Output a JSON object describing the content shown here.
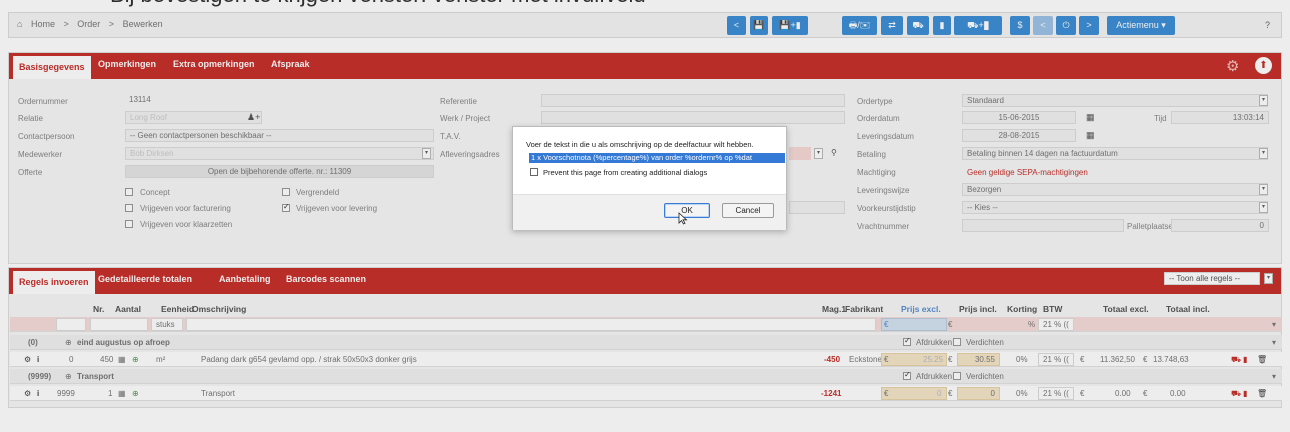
{
  "top_fragment": "Bij bevestigen te krijgen venster: venster met invulfveld",
  "breadcrumb": [
    "Home",
    ">",
    "Order",
    ">",
    "Bewerken"
  ],
  "toolbar": {
    "buttons": [
      "<",
      "💾",
      "💾+▮",
      "🖶/✉",
      "⇄",
      "⛟",
      "▮",
      "⛟+▮",
      "$",
      "<",
      "⏻",
      ">"
    ],
    "actiemenu": "Actiemenu ▾",
    "help": "?"
  },
  "basis": {
    "tabs": [
      "Basisgegevens",
      "Opmerkingen",
      "Extra opmerkingen",
      "Afspraak"
    ],
    "left": {
      "ordernummer_label": "Ordernummer",
      "ordernummer": "13114",
      "relatie_label": "Relatie",
      "relatie": "Long Roof",
      "contactpersoon_label": "Contactpersoon",
      "contactpersoon": "-- Geen contactpersonen beschikbaar --",
      "medewerker_label": "Medewerker",
      "medewerker": "Bob Dirksen",
      "offerte_label": "Offerte",
      "offerte": "Open de bijbehorende offerte. nr.: 11309"
    },
    "checks": {
      "concept": "Concept",
      "vergrendeld": "Vergrendeld",
      "facturering": "Vrijgeven voor facturering",
      "levering": "Vrijgeven voor levering",
      "klaarzetten": "Vrijgeven voor klaarzetten"
    },
    "mid": {
      "referentie": "Referentie",
      "werk": "Werk / Project",
      "tav": "T.A.V.",
      "aflevering": "Afleveringsadres"
    },
    "right": {
      "ordertype_label": "Ordertype",
      "ordertype": "Standaard",
      "orderdatum_label": "Orderdatum",
      "orderdatum": "15-06-2015",
      "tijd_label": "Tijd",
      "tijd": "13:03:14",
      "leveringsdatum_label": "Leveringsdatum",
      "leveringsdatum": "28-08-2015",
      "betaling_label": "Betaling",
      "betaling": "Betaling binnen 14 dagen na factuurdatum",
      "machtiging_label": "Machtiging",
      "machtiging": "Geen geldige SEPA-machtigingen",
      "leveringswijze_label": "Leveringswijze",
      "leveringswijze": "Bezorgen",
      "voorkeur_label": "Voorkeurstijdstip",
      "voorkeur": "-- Kies --",
      "vracht_label": "Vrachtnummer",
      "pallet_label": "Palletplaatsen",
      "pallet": "0"
    }
  },
  "regels": {
    "tabs": [
      "Regels invoeren",
      "Gedetailleerde totalen",
      "Aanbetaling",
      "Barcodes scannen"
    ],
    "filter": "-- Toon alle regels --",
    "headers": {
      "nr": "Nr.",
      "aantal": "Aantal",
      "eenheid": "Eenheid",
      "omschrijving": "Omschrijving",
      "mag": "Mag.1",
      "fabrikant": "Fabrikant",
      "prijs_excl": "Prijs excl.",
      "prijs_incl": "Prijs incl.",
      "korting": "Korting",
      "btw": "BTW",
      "totaal_excl": "Totaal excl.",
      "totaal_incl": "Totaal incl."
    },
    "new_row": {
      "eenheid": "stuks",
      "euro1": "€",
      "euro2": "€",
      "pct": "%",
      "btw": "21 % (("
    },
    "group1": {
      "nr": "(0)",
      "name": "eind augustus op afroep",
      "afdrukken": "Afdrukken",
      "verdichten": "Verdichten"
    },
    "row1": {
      "nr": "0",
      "aantal": "450",
      "eenheid": "m²",
      "omschrijving": "Padang dark g654 gevlamd opp. / strak 50x50x3 donker grijs",
      "mag": "-450",
      "fabrikant": "Eckstone B.V.",
      "euro_a": "€",
      "prijs_excl": "25.25",
      "euro_b": "€",
      "prijs_incl": "30.55",
      "korting": "0%",
      "btw": "21 % ((",
      "euro_c": "€",
      "totaal_excl": "11.362,50",
      "euro_d": "€",
      "totaal_incl": "13.748,63"
    },
    "group2": {
      "nr": "(9999)",
      "name": "Transport",
      "afdrukken": "Afdrukken",
      "verdichten": "Verdichten"
    },
    "row2": {
      "nr": "9999",
      "aantal": "1",
      "omschrijving": "Transport",
      "mag": "-1241",
      "euro_a": "€",
      "prijs_excl": "0",
      "euro_b": "€",
      "prijs_incl": "0",
      "korting": "0%",
      "btw": "21 % ((",
      "euro_c": "€",
      "totaal_excl": "0.00",
      "euro_d": "€",
      "totaal_incl": "0.00"
    }
  },
  "dialog": {
    "message": "Voer de tekst in die u als omschrijving op de deelfactuur wilt hebben.",
    "input_value": "1 x Voorschotnota (%percentage%) van order %ordernr% op %dat",
    "prevent_label": "Prevent this page from creating additional dialogs",
    "ok": "OK",
    "cancel": "Cancel"
  },
  "colors": {
    "brand_red": "#c7312c",
    "toolbar_blue": "#3d8fd6",
    "selection_blue": "#3479d6"
  }
}
